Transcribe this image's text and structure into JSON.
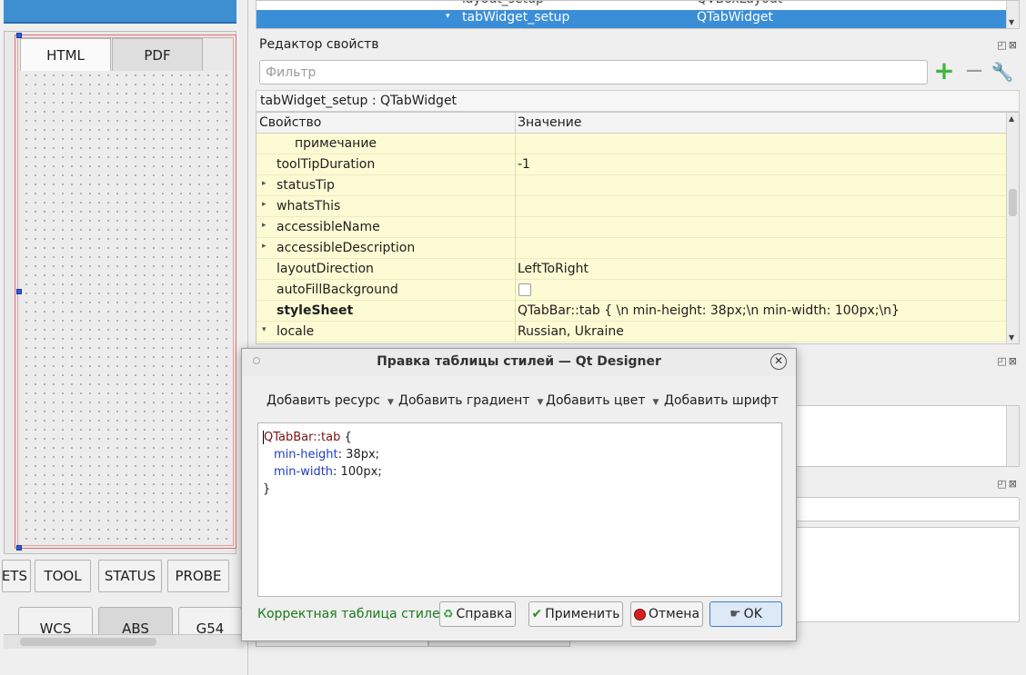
{
  "canvas": {
    "tabs": [
      "HTML",
      "PDF"
    ],
    "status_buttons": [
      "ETS",
      "TOOL",
      "STATUS",
      "PROBE"
    ],
    "wcs_buttons": [
      "WCS",
      "ABS",
      "G54"
    ]
  },
  "object_tree": {
    "prev_name": "layout_setup",
    "prev_class": "QVBoxLayout",
    "selected_name": "tabWidget_setup",
    "selected_class": "QTabWidget"
  },
  "property_editor": {
    "title": "Редактор свойств",
    "filter_placeholder": "Фильтр",
    "object_label": "tabWidget_setup : QTabWidget",
    "headers": {
      "property": "Свойство",
      "value": "Значение"
    },
    "rows": [
      {
        "name": "примечание",
        "value": "",
        "expander": ""
      },
      {
        "name": "toolTipDuration",
        "value": "-1",
        "expander": ""
      },
      {
        "name": "statusTip",
        "value": "",
        "expander": "▸"
      },
      {
        "name": "whatsThis",
        "value": "",
        "expander": "▸"
      },
      {
        "name": "accessibleName",
        "value": "",
        "expander": "▸"
      },
      {
        "name": "accessibleDescription",
        "value": "",
        "expander": "▸"
      },
      {
        "name": "layoutDirection",
        "value": "LeftToRight",
        "expander": ""
      },
      {
        "name": "autoFillBackground",
        "value": "",
        "expander": ""
      },
      {
        "name": "styleSheet",
        "value": "QTabBar::tab {   \\n    min-height: 38px;\\n    min-width: 100px;\\n}",
        "expander": ""
      },
      {
        "name": "locale",
        "value": "Russian, Ukraine",
        "expander": "▾"
      }
    ]
  },
  "dialog": {
    "title": "Правка таблицы стилей — Qt Designer",
    "toolbar": [
      "Добавить ресурс",
      "Добавить градиент",
      "Добавить цвет",
      "Добавить шрифт"
    ],
    "code": {
      "selector_a": "QTabBar",
      "selector_sep": "::",
      "selector_b": "tab",
      "open_brace": " {",
      "prop1": "min-height",
      "val1": ": 38px;",
      "prop2": "min-width",
      "val2": ": 100px;",
      "close_brace": "}"
    },
    "status": "Корректная таблица стилей",
    "buttons": {
      "help": "Справка",
      "apply": "Применить",
      "cancel": "Отмена",
      "ok": "OK"
    }
  },
  "colors": {
    "selection": "#3a8ed8",
    "property_row": "#fdfbd3",
    "valid_text": "#1a7a1a"
  }
}
